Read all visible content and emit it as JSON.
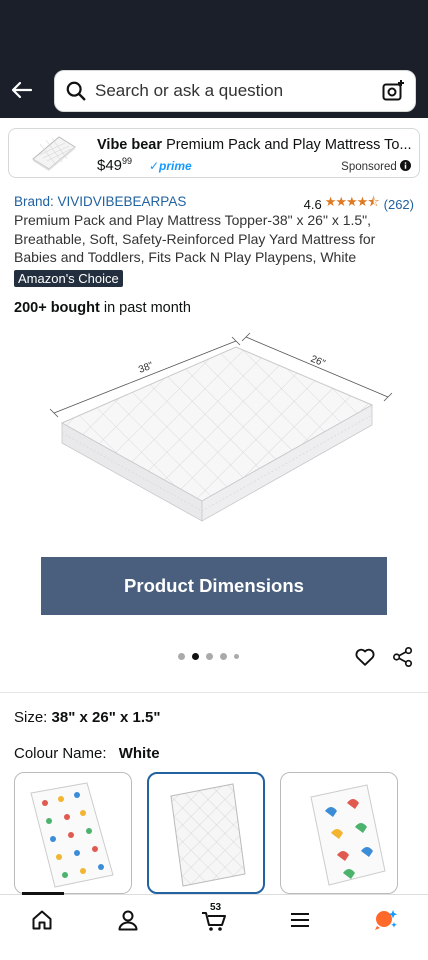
{
  "header": {
    "search_placeholder": "Search or ask a question"
  },
  "sponsored": {
    "brand": "Vibe bear",
    "title": "Premium Pack and Play Mattress To...",
    "price_whole": "$49",
    "price_fraction": "99",
    "prime_label": "✓prime",
    "sponsored_label": "Sponsored"
  },
  "product": {
    "brand_label": "Brand: VIVIDVIBEBEARPAS",
    "rating_value": "4.6",
    "rating_stars": "★★★★⯪",
    "rating_count": "(262)",
    "title": "Premium Pack and Play Mattress Topper-38\" x 26\" x 1.5\", Breathable, Soft, Safety-Reinforced Play Yard Mattress for Babies and Toddlers, Fits Pack N Play Playpens, White",
    "badge": "Amazon's Choice",
    "bought_bold": "200+ bought",
    "bought_rest": " in past month",
    "dim_length": "38\"",
    "dim_width": "26\"",
    "banner": "Product Dimensions",
    "image_count": 5,
    "image_index": 2
  },
  "variants": {
    "size_label": "Size:",
    "size_value": "38\" x 26\" x 1.5\"",
    "colour_label": "Colour Name:",
    "colour_value": "White"
  },
  "nav": {
    "cart_count": "53"
  },
  "colors": {
    "top_bar": "#1a1f29",
    "link": "#2162a1",
    "banner": "#4a5f7e",
    "star": "#de7921",
    "prime": "#1399ff",
    "rufus": "#ff6a2b"
  }
}
